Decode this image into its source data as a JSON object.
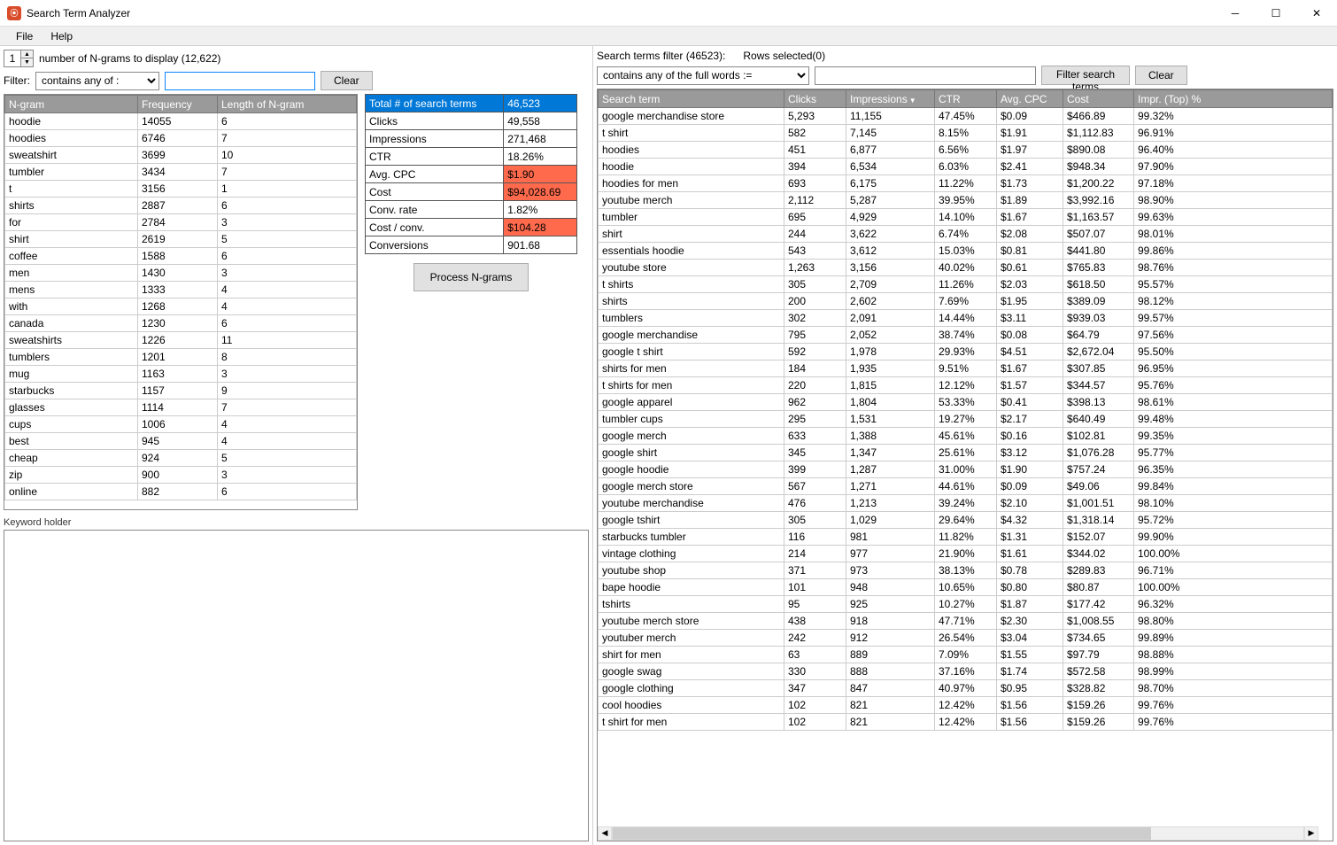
{
  "window": {
    "title": "Search Term Analyzer"
  },
  "menu": {
    "file": "File",
    "help": "Help"
  },
  "ngram_controls": {
    "spinner_value": "1",
    "display_label": "number of N-grams to display (12,622)",
    "filter_label": "Filter:",
    "filter_mode": "contains any of :",
    "filter_value": "",
    "clear": "Clear"
  },
  "ngram_headers": [
    "N-gram",
    "Frequency",
    "Length of N-gram"
  ],
  "ngram_rows": [
    [
      "hoodie",
      "14055",
      "6"
    ],
    [
      "hoodies",
      "6746",
      "7"
    ],
    [
      "sweatshirt",
      "3699",
      "10"
    ],
    [
      "tumbler",
      "3434",
      "7"
    ],
    [
      "t",
      "3156",
      "1"
    ],
    [
      "shirts",
      "2887",
      "6"
    ],
    [
      "for",
      "2784",
      "3"
    ],
    [
      "shirt",
      "2619",
      "5"
    ],
    [
      "coffee",
      "1588",
      "6"
    ],
    [
      "men",
      "1430",
      "3"
    ],
    [
      "mens",
      "1333",
      "4"
    ],
    [
      "with",
      "1268",
      "4"
    ],
    [
      "canada",
      "1230",
      "6"
    ],
    [
      "sweatshirts",
      "1226",
      "11"
    ],
    [
      "tumblers",
      "1201",
      "8"
    ],
    [
      "mug",
      "1163",
      "3"
    ],
    [
      "starbucks",
      "1157",
      "9"
    ],
    [
      "glasses",
      "1114",
      "7"
    ],
    [
      "cups",
      "1006",
      "4"
    ],
    [
      "best",
      "945",
      "4"
    ],
    [
      "cheap",
      "924",
      "5"
    ],
    [
      "zip",
      "900",
      "3"
    ],
    [
      "online",
      "882",
      "6"
    ]
  ],
  "summary": {
    "total_label": "Total # of search terms",
    "total_value": "46,523",
    "clicks_label": "Clicks",
    "clicks_value": "49,558",
    "impr_label": "Impressions",
    "impr_value": "271,468",
    "ctr_label": "CTR",
    "ctr_value": "18.26%",
    "cpc_label": "Avg. CPC",
    "cpc_value": "$1.90",
    "cost_label": "Cost",
    "cost_value": "$94,028.69",
    "convrate_label": "Conv. rate",
    "convrate_value": "1.82%",
    "costconv_label": "Cost / conv.",
    "costconv_value": "$104.28",
    "conv_label": "Conversions",
    "conv_value": "901.68"
  },
  "process_btn": "Process N-grams",
  "keyword_holder_label": "Keyword holder",
  "right": {
    "filter_label": "Search terms filter (46523):",
    "rows_selected": "Rows selected(0)",
    "filter_mode": "contains any of the full words :=",
    "filter_value": "",
    "filter_btn": "Filter search terms",
    "clear": "Clear"
  },
  "search_headers": [
    "Search term",
    "Clicks",
    "Impressions",
    "CTR",
    "Avg. CPC",
    "Cost",
    "Impr. (Top) %"
  ],
  "search_rows": [
    [
      "google merchandise store",
      "5,293",
      "11,155",
      "47.45%",
      "$0.09",
      "$466.89",
      "99.32%"
    ],
    [
      "t shirt",
      "582",
      "7,145",
      "8.15%",
      "$1.91",
      "$1,112.83",
      "96.91%"
    ],
    [
      "hoodies",
      "451",
      "6,877",
      "6.56%",
      "$1.97",
      "$890.08",
      "96.40%"
    ],
    [
      "hoodie",
      "394",
      "6,534",
      "6.03%",
      "$2.41",
      "$948.34",
      "97.90%"
    ],
    [
      "hoodies for men",
      "693",
      "6,175",
      "11.22%",
      "$1.73",
      "$1,200.22",
      "97.18%"
    ],
    [
      "youtube merch",
      "2,112",
      "5,287",
      "39.95%",
      "$1.89",
      "$3,992.16",
      "98.90%"
    ],
    [
      "tumbler",
      "695",
      "4,929",
      "14.10%",
      "$1.67",
      "$1,163.57",
      "99.63%"
    ],
    [
      "shirt",
      "244",
      "3,622",
      "6.74%",
      "$2.08",
      "$507.07",
      "98.01%"
    ],
    [
      "essentials hoodie",
      "543",
      "3,612",
      "15.03%",
      "$0.81",
      "$441.80",
      "99.86%"
    ],
    [
      "youtube store",
      "1,263",
      "3,156",
      "40.02%",
      "$0.61",
      "$765.83",
      "98.76%"
    ],
    [
      "t shirts",
      "305",
      "2,709",
      "11.26%",
      "$2.03",
      "$618.50",
      "95.57%"
    ],
    [
      "shirts",
      "200",
      "2,602",
      "7.69%",
      "$1.95",
      "$389.09",
      "98.12%"
    ],
    [
      "tumblers",
      "302",
      "2,091",
      "14.44%",
      "$3.11",
      "$939.03",
      "99.57%"
    ],
    [
      "google merchandise",
      "795",
      "2,052",
      "38.74%",
      "$0.08",
      "$64.79",
      "97.56%"
    ],
    [
      "google t shirt",
      "592",
      "1,978",
      "29.93%",
      "$4.51",
      "$2,672.04",
      "95.50%"
    ],
    [
      "shirts for men",
      "184",
      "1,935",
      "9.51%",
      "$1.67",
      "$307.85",
      "96.95%"
    ],
    [
      "t shirts for men",
      "220",
      "1,815",
      "12.12%",
      "$1.57",
      "$344.57",
      "95.76%"
    ],
    [
      "google apparel",
      "962",
      "1,804",
      "53.33%",
      "$0.41",
      "$398.13",
      "98.61%"
    ],
    [
      "tumbler cups",
      "295",
      "1,531",
      "19.27%",
      "$2.17",
      "$640.49",
      "99.48%"
    ],
    [
      "google merch",
      "633",
      "1,388",
      "45.61%",
      "$0.16",
      "$102.81",
      "99.35%"
    ],
    [
      "google shirt",
      "345",
      "1,347",
      "25.61%",
      "$3.12",
      "$1,076.28",
      "95.77%"
    ],
    [
      "google hoodie",
      "399",
      "1,287",
      "31.00%",
      "$1.90",
      "$757.24",
      "96.35%"
    ],
    [
      "google merch store",
      "567",
      "1,271",
      "44.61%",
      "$0.09",
      "$49.06",
      "99.84%"
    ],
    [
      "youtube merchandise",
      "476",
      "1,213",
      "39.24%",
      "$2.10",
      "$1,001.51",
      "98.10%"
    ],
    [
      "google tshirt",
      "305",
      "1,029",
      "29.64%",
      "$4.32",
      "$1,318.14",
      "95.72%"
    ],
    [
      "starbucks tumbler",
      "116",
      "981",
      "11.82%",
      "$1.31",
      "$152.07",
      "99.90%"
    ],
    [
      "vintage clothing",
      "214",
      "977",
      "21.90%",
      "$1.61",
      "$344.02",
      "100.00%"
    ],
    [
      "youtube shop",
      "371",
      "973",
      "38.13%",
      "$0.78",
      "$289.83",
      "96.71%"
    ],
    [
      "bape hoodie",
      "101",
      "948",
      "10.65%",
      "$0.80",
      "$80.87",
      "100.00%"
    ],
    [
      "tshirts",
      "95",
      "925",
      "10.27%",
      "$1.87",
      "$177.42",
      "96.32%"
    ],
    [
      "youtube merch store",
      "438",
      "918",
      "47.71%",
      "$2.30",
      "$1,008.55",
      "98.80%"
    ],
    [
      "youtuber merch",
      "242",
      "912",
      "26.54%",
      "$3.04",
      "$734.65",
      "99.89%"
    ],
    [
      "shirt for men",
      "63",
      "889",
      "7.09%",
      "$1.55",
      "$97.79",
      "98.88%"
    ],
    [
      "google swag",
      "330",
      "888",
      "37.16%",
      "$1.74",
      "$572.58",
      "98.99%"
    ],
    [
      "google clothing",
      "347",
      "847",
      "40.97%",
      "$0.95",
      "$328.82",
      "98.70%"
    ],
    [
      "cool hoodies",
      "102",
      "821",
      "12.42%",
      "$1.56",
      "$159.26",
      "99.76%"
    ],
    [
      "t shirt for men",
      "102",
      "821",
      "12.42%",
      "$1.56",
      "$159.26",
      "99.76%"
    ]
  ]
}
